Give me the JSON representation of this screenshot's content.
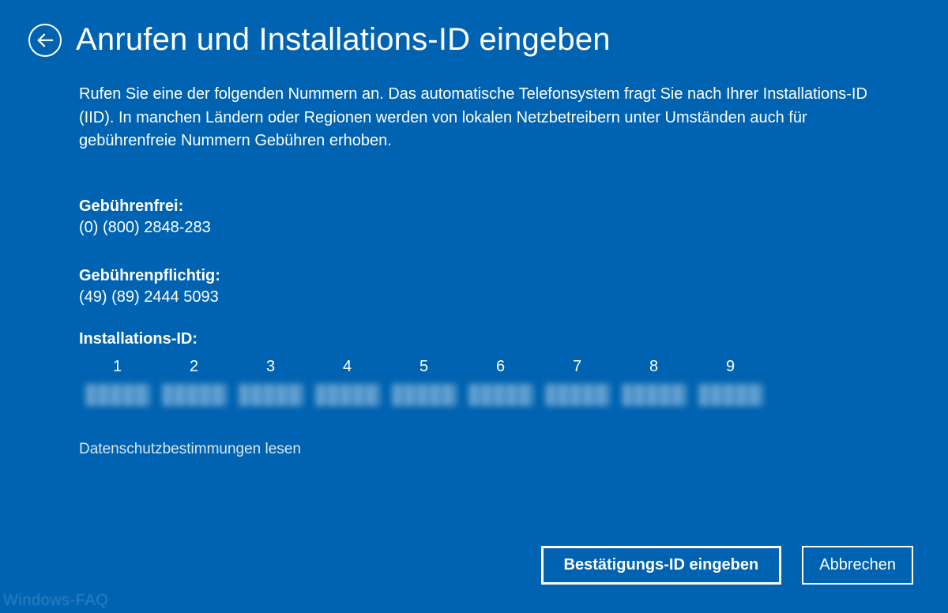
{
  "header": {
    "title": "Anrufen und Installations-ID eingeben"
  },
  "description": "Rufen Sie eine der folgenden Nummern an. Das automatische Telefonsystem fragt Sie nach Ihrer Installations-ID (IID). In manchen Ländern oder Regionen werden von lokalen Netzbetreibern unter Umständen auch für gebührenfreie Nummern Gebühren erhoben.",
  "toll_free": {
    "label": "Gebührenfrei:",
    "number": "(0) (800) 2848-283"
  },
  "toll": {
    "label": "Gebührenpflichtig:",
    "number": "(49) (89) 2444 5093"
  },
  "iid": {
    "label": "Installations-ID:",
    "columns": [
      "1",
      "2",
      "3",
      "4",
      "5",
      "6",
      "7",
      "8",
      "9"
    ]
  },
  "privacy_link": "Datenschutzbestimmungen lesen",
  "buttons": {
    "confirm": "Bestätigungs-ID eingeben",
    "cancel": "Abbrechen"
  },
  "watermark": "Windows-FAQ"
}
